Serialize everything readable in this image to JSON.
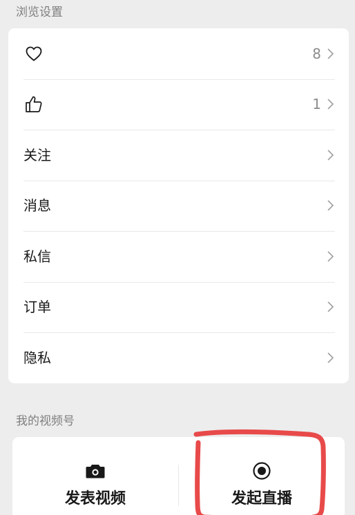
{
  "browse_section": {
    "title": "浏览设置",
    "rows": [
      {
        "icon": "heart-icon",
        "label": "",
        "count": "8"
      },
      {
        "icon": "thumbs-up-icon",
        "label": "",
        "count": "1"
      },
      {
        "icon": "",
        "label": "关注",
        "count": ""
      },
      {
        "icon": "",
        "label": "消息",
        "count": ""
      },
      {
        "icon": "",
        "label": "私信",
        "count": ""
      },
      {
        "icon": "",
        "label": "订单",
        "count": ""
      },
      {
        "icon": "",
        "label": "隐私",
        "count": ""
      }
    ]
  },
  "video_section": {
    "title": "我的视频号",
    "post_video_label": "发表视频",
    "post_video_icon": "camera-icon",
    "start_live_label": "发起直播",
    "start_live_icon": "live-record-icon"
  },
  "colors": {
    "background": "#ededed",
    "card": "#ffffff",
    "highlight_annotation": "#e84a4a",
    "secondary_text": "#8c8c8c"
  }
}
